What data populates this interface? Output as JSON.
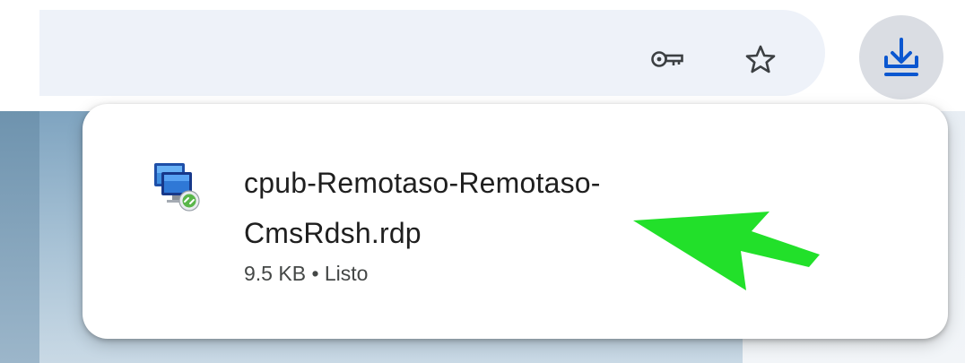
{
  "toolbar": {
    "icons": {
      "password_key": "key-icon",
      "bookmark": "star-icon",
      "downloads": "download-icon"
    },
    "accent_color": "#0b57d0"
  },
  "download": {
    "file_name": "cpub-Remotaso-Remotaso-CmsRdsh.rdp",
    "size": "9.5 KB",
    "separator": "•",
    "status": "Listo",
    "file_icon": "remote-desktop-file-icon"
  },
  "annotation": {
    "type": "arrow",
    "color": "#22e02a"
  }
}
